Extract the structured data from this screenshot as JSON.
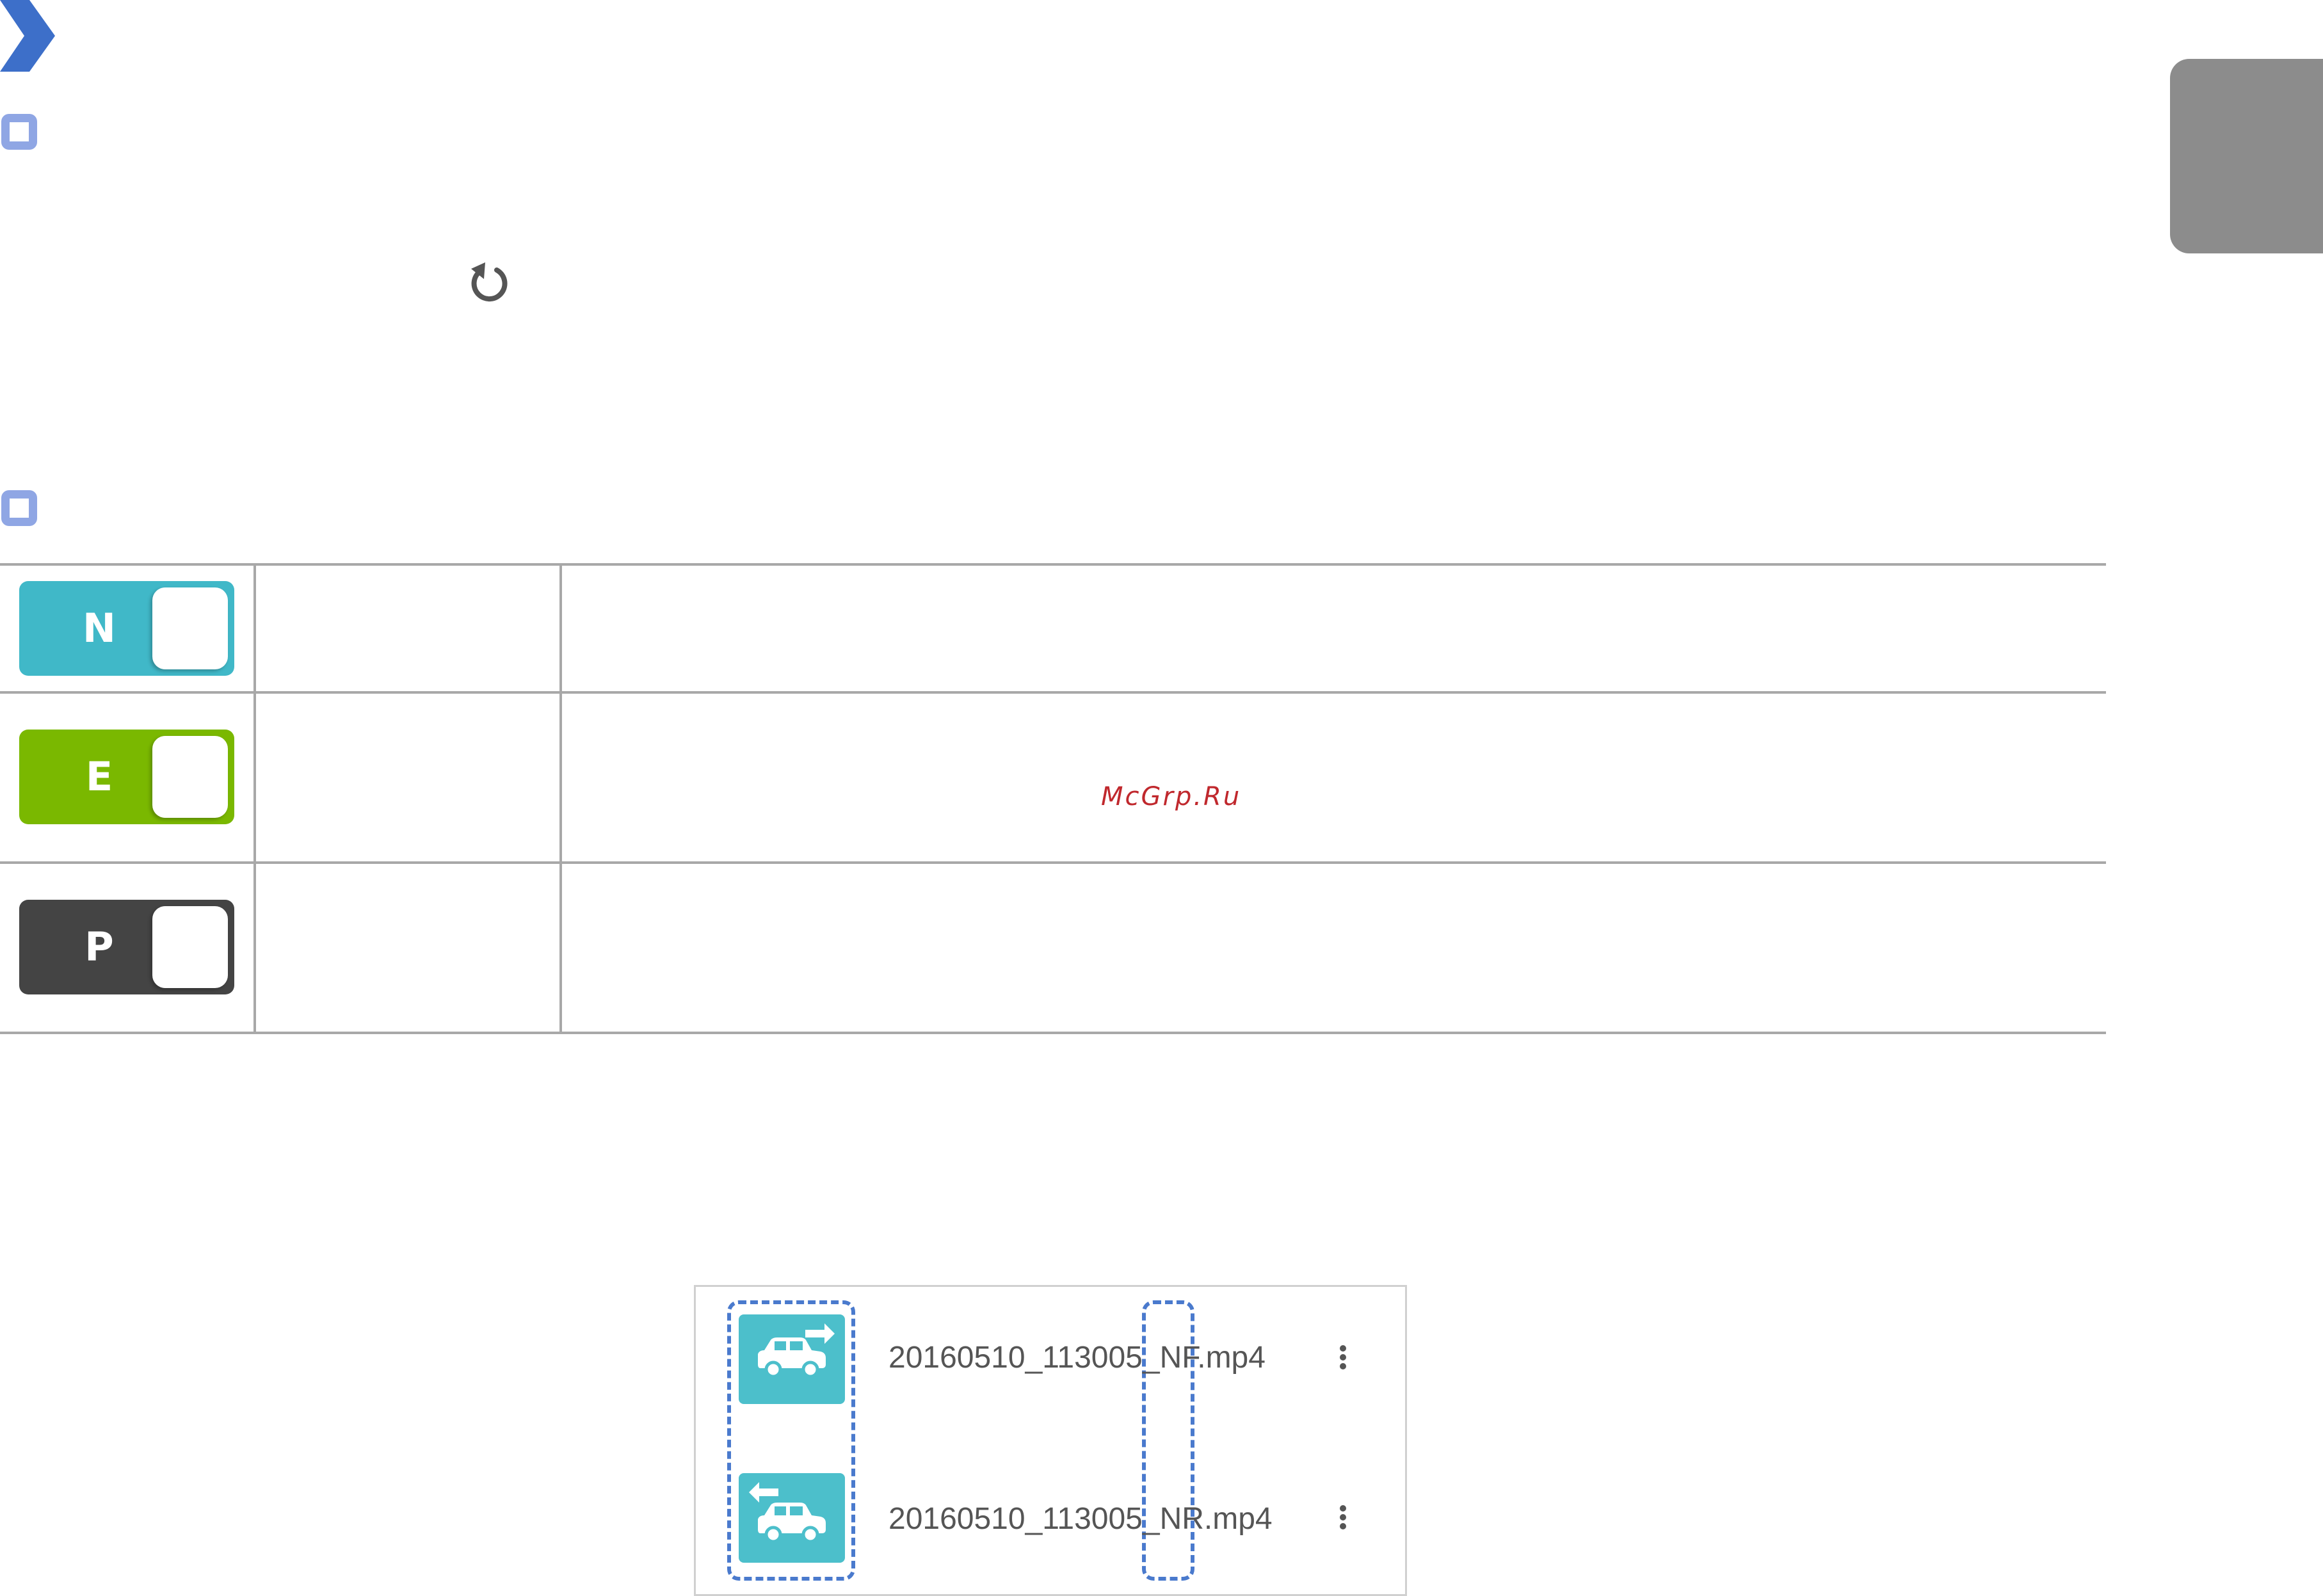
{
  "colors": {
    "accent_blue": "#3d6fc9",
    "bullet_outline": "#8fa6e4",
    "side_tab": "#8c8c8c",
    "table_rule": "#a8a8a8",
    "mode_n": "#40b8c8",
    "mode_e": "#7ab800",
    "mode_p": "#444444",
    "file_icon": "#4cbfcb",
    "watermark": "#c0282d"
  },
  "icons": {
    "section_marker": "chevron-right-icon",
    "bullet": "square-bullet-icon",
    "reload": "refresh-icon",
    "front_camera": "car-arrow-right-icon",
    "rear_camera": "car-arrow-left-icon",
    "more": "kebab-menu-icon"
  },
  "modes": [
    {
      "letter": "N",
      "color": "#40b8c8"
    },
    {
      "letter": "E",
      "color": "#7ab800"
    },
    {
      "letter": "P",
      "color": "#444444"
    }
  ],
  "watermark": "McGrp.Ru",
  "files": [
    {
      "name": "20160510_113005_NF.mp4",
      "camera": "front"
    },
    {
      "name": "20160510_113005_NR.mp4",
      "camera": "rear"
    }
  ]
}
